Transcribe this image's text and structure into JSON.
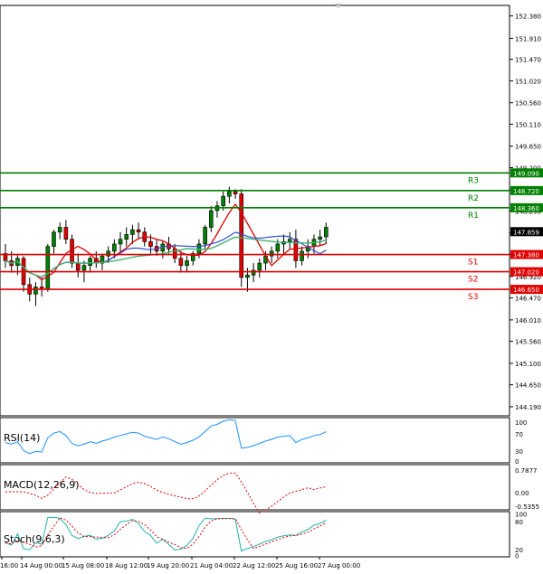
{
  "chart_data": {
    "type": "candlestick",
    "instrument_hint": "",
    "y_axis": {
      "ticks": [
        "152.380",
        "151.910",
        "151.470",
        "151.020",
        "150.560",
        "150.110",
        "149.650",
        "149.200",
        "148.740",
        "148.290",
        "147.830",
        "147.380",
        "146.920",
        "146.470",
        "146.010",
        "145.560",
        "145.100",
        "144.650",
        "144.190"
      ],
      "range": [
        144.19,
        152.6
      ]
    },
    "x_axis": {
      "ticks": [
        "16:00",
        "14 Aug 00:00",
        "15 Aug 08:00",
        "18 Aug 12:00",
        "19 Aug 20:00",
        "21 Aug 04:00",
        "22 Aug 12:00",
        "25 Aug 16:00",
        "27 Aug 00:00"
      ]
    },
    "current_price": "147.859",
    "levels": [
      {
        "name": "R3",
        "value": "149.090",
        "kind": "resistance"
      },
      {
        "name": "R2",
        "value": "148.720",
        "kind": "resistance"
      },
      {
        "name": "R1",
        "value": "148.360",
        "kind": "resistance"
      },
      {
        "name": "S1",
        "value": "147.380",
        "kind": "support"
      },
      {
        "name": "S2",
        "value": "147.020",
        "kind": "support"
      },
      {
        "name": "S3",
        "value": "146.650",
        "kind": "support"
      }
    ],
    "candles": [
      [
        147.4,
        147.6,
        147.1,
        147.25
      ],
      [
        147.25,
        147.45,
        147.0,
        147.15
      ],
      [
        147.15,
        147.4,
        146.95,
        147.3
      ],
      [
        147.3,
        147.35,
        146.6,
        146.75
      ],
      [
        146.75,
        146.9,
        146.4,
        146.55
      ],
      [
        146.55,
        146.8,
        146.3,
        146.7
      ],
      [
        146.7,
        146.9,
        146.5,
        146.65
      ],
      [
        146.65,
        147.6,
        146.6,
        147.55
      ],
      [
        147.55,
        147.9,
        147.4,
        147.85
      ],
      [
        147.85,
        148.05,
        147.7,
        147.95
      ],
      [
        147.95,
        148.1,
        147.6,
        147.7
      ],
      [
        147.7,
        147.8,
        147.1,
        147.2
      ],
      [
        147.2,
        147.4,
        146.9,
        147.05
      ],
      [
        147.05,
        147.25,
        146.8,
        147.15
      ],
      [
        147.15,
        147.35,
        147.0,
        147.3
      ],
      [
        147.3,
        147.45,
        147.1,
        147.2
      ],
      [
        147.2,
        147.4,
        147.05,
        147.35
      ],
      [
        147.35,
        147.55,
        147.2,
        147.45
      ],
      [
        147.45,
        147.7,
        147.3,
        147.6
      ],
      [
        147.6,
        147.85,
        147.45,
        147.7
      ],
      [
        147.7,
        147.95,
        147.55,
        147.8
      ],
      [
        147.8,
        148.0,
        147.6,
        147.9
      ],
      [
        147.9,
        148.05,
        147.7,
        147.85
      ],
      [
        147.85,
        147.95,
        147.55,
        147.65
      ],
      [
        147.65,
        147.8,
        147.4,
        147.55
      ],
      [
        147.55,
        147.7,
        147.35,
        147.45
      ],
      [
        147.45,
        147.65,
        147.3,
        147.6
      ],
      [
        147.6,
        147.75,
        147.4,
        147.5
      ],
      [
        147.5,
        147.6,
        147.2,
        147.3
      ],
      [
        147.3,
        147.45,
        147.0,
        147.15
      ],
      [
        147.15,
        147.35,
        147.0,
        147.25
      ],
      [
        147.25,
        147.45,
        147.15,
        147.4
      ],
      [
        147.4,
        147.7,
        147.3,
        147.6
      ],
      [
        147.6,
        148.0,
        147.5,
        147.95
      ],
      [
        147.95,
        148.4,
        147.85,
        148.3
      ],
      [
        148.3,
        148.5,
        148.15,
        148.4
      ],
      [
        148.4,
        148.7,
        148.3,
        148.6
      ],
      [
        148.6,
        148.8,
        148.45,
        148.7
      ],
      [
        148.7,
        148.75,
        148.55,
        148.65
      ],
      [
        148.65,
        148.75,
        146.7,
        146.9
      ],
      [
        146.9,
        147.1,
        146.6,
        146.95
      ],
      [
        146.95,
        147.2,
        146.8,
        147.05
      ],
      [
        147.05,
        147.3,
        146.9,
        147.2
      ],
      [
        147.2,
        147.45,
        147.05,
        147.35
      ],
      [
        147.35,
        147.55,
        147.2,
        147.45
      ],
      [
        147.45,
        147.7,
        147.3,
        147.6
      ],
      [
        147.6,
        147.8,
        147.4,
        147.65
      ],
      [
        147.65,
        147.85,
        147.5,
        147.7
      ],
      [
        147.7,
        147.9,
        147.1,
        147.25
      ],
      [
        147.25,
        147.55,
        147.15,
        147.45
      ],
      [
        147.45,
        147.7,
        147.3,
        147.55
      ],
      [
        147.55,
        147.8,
        147.4,
        147.7
      ],
      [
        147.7,
        147.9,
        147.55,
        147.75
      ],
      [
        147.75,
        148.05,
        147.6,
        147.95
      ]
    ],
    "indicators": [
      {
        "name": "RSI(14)",
        "ticks": [
          "100",
          "70",
          "30",
          "0"
        ]
      },
      {
        "name": "MACD(12,26,9)",
        "ticks": [
          "0.7877",
          "0.00",
          "-0.5355"
        ]
      },
      {
        "name": "Stoch(9,6,3)",
        "ticks": [
          "100",
          "80",
          "20",
          "0"
        ]
      }
    ],
    "colors": {
      "resistance": "#008000",
      "support": "#e00000",
      "bull": "#008000",
      "bear": "#e00000",
      "ma_green": "#3cb371",
      "ma_blue": "#3050d0",
      "ma_red": "#e00000",
      "rsi": "#1e90ff",
      "macd": "#e00000",
      "stoch_main": "#20b2aa",
      "stoch_signal": "#e00000",
      "price_box": "#000000",
      "axis": "#000000",
      "grid": "#c0c0c0"
    }
  }
}
